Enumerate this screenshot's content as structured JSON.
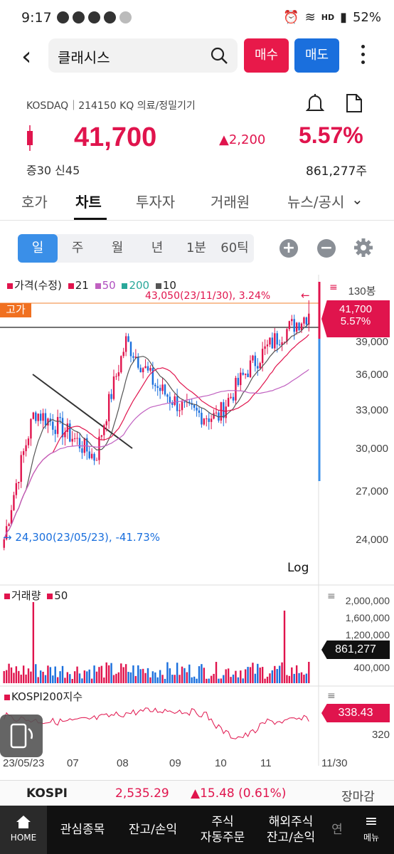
{
  "status": {
    "time": "9:17",
    "battery": "52%",
    "net": "HD"
  },
  "header": {
    "search_value": "클래시스",
    "buy_label": "매수",
    "sell_label": "매도"
  },
  "stock": {
    "market_line": "KOSDAQ｜214150 KQ 의료/정밀기기",
    "price": "41,700",
    "change": "▲2,200",
    "change_pct": "5.57%",
    "margin_info": "증30 신45",
    "volume": "861,277주"
  },
  "tabs": [
    "호가",
    "차트",
    "투자자",
    "거래원",
    "뉴스/공시"
  ],
  "periods": [
    "일",
    "주",
    "월",
    "년",
    "1분",
    "60틱"
  ],
  "colors": {
    "up": "#e0144d",
    "down": "#1a6fdd",
    "accent": "#3a8fe8",
    "ma21": "#e0144d",
    "ma50": "#c060c0",
    "ma200": "#2aa89a",
    "ma10": "#555555"
  },
  "price_panel": {
    "legend": {
      "price": "가격(수정)",
      "ma1": "21",
      "ma2": "50",
      "ma3": "200",
      "ma4": "10"
    },
    "period_count": "130봉",
    "high_tag": "고가",
    "high_note": "43,050(23/11/30), 3.24%",
    "low_note": "24,300(23/05/23), -41.73%",
    "current_price_tag": "41,700",
    "current_pct_tag": "5.57%",
    "y_labels": [
      "39,000",
      "36,000",
      "33,000",
      "30,000",
      "27,000",
      "24,000"
    ],
    "scale_label": "Log"
  },
  "volume_panel": {
    "legend": {
      "name": "거래량",
      "ma": "50"
    },
    "y_labels": [
      "2,000,000",
      "1,600,000",
      "1,200,000",
      "400,000"
    ],
    "current_tag": "861,277"
  },
  "index_panel": {
    "legend": "KOSPI200지수",
    "current_tag": "338.43",
    "y_labels": [
      "320"
    ]
  },
  "x_labels": [
    "23/05/23",
    "07",
    "08",
    "09",
    "10",
    "11",
    "11/30"
  ],
  "kospi_bar": {
    "name": "KOSPI",
    "value": "2,535.29",
    "change": "▲15.48 (0.61%)",
    "session": "장마감"
  },
  "nav": {
    "home": "HOME",
    "items": [
      "관심종목",
      "잔고/손익",
      "주식\n자동주문",
      "해외주식\n잔고/손익",
      "연"
    ],
    "menu": "메뉴"
  },
  "chart_data": {
    "type": "candlestick",
    "x": [
      "23/05/23",
      "07",
      "08",
      "09",
      "10",
      "11",
      "11/30"
    ],
    "close_approx": [
      24300,
      33000,
      31500,
      29500,
      39000,
      35000,
      33000,
      32500,
      36500,
      39500,
      41700
    ],
    "high": 43050,
    "low": 24300,
    "last_close": 41700,
    "y_scale": "log",
    "ylim": [
      22000,
      45000
    ]
  }
}
